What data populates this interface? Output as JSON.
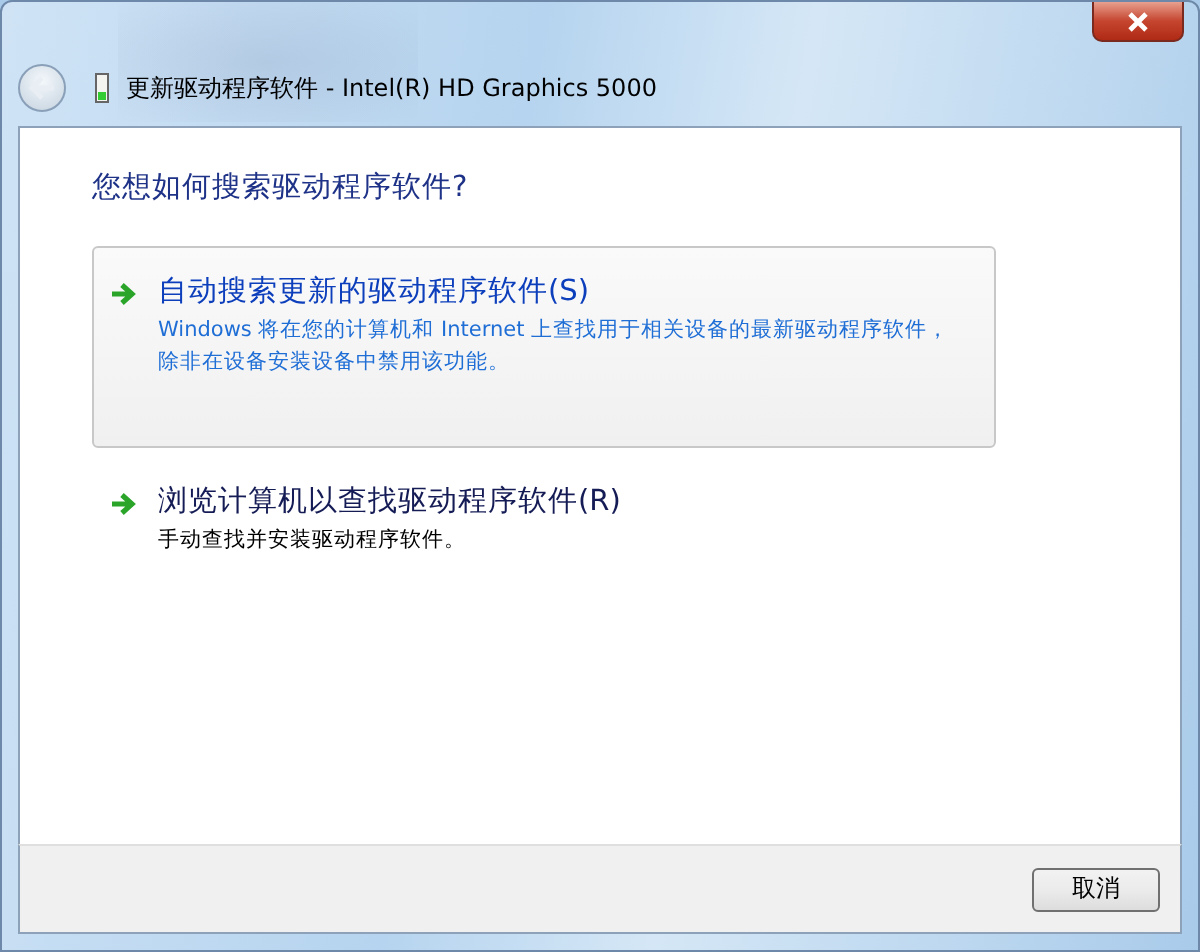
{
  "window": {
    "title": "更新驱动程序软件 - Intel(R) HD Graphics 5000"
  },
  "heading": "您想如何搜索驱动程序软件?",
  "options": [
    {
      "label": "自动搜索更新的驱动程序软件(S)",
      "description": "Windows 将在您的计算机和 Internet 上查找用于相关设备的最新驱动程序软件，除非在设备安装设备中禁用该功能。",
      "hovered": true
    },
    {
      "label": "浏览计算机以查找驱动程序软件(R)",
      "description": "手动查找并安装驱动程序软件。",
      "hovered": false
    }
  ],
  "buttons": [
    {
      "label": "取消"
    }
  ]
}
